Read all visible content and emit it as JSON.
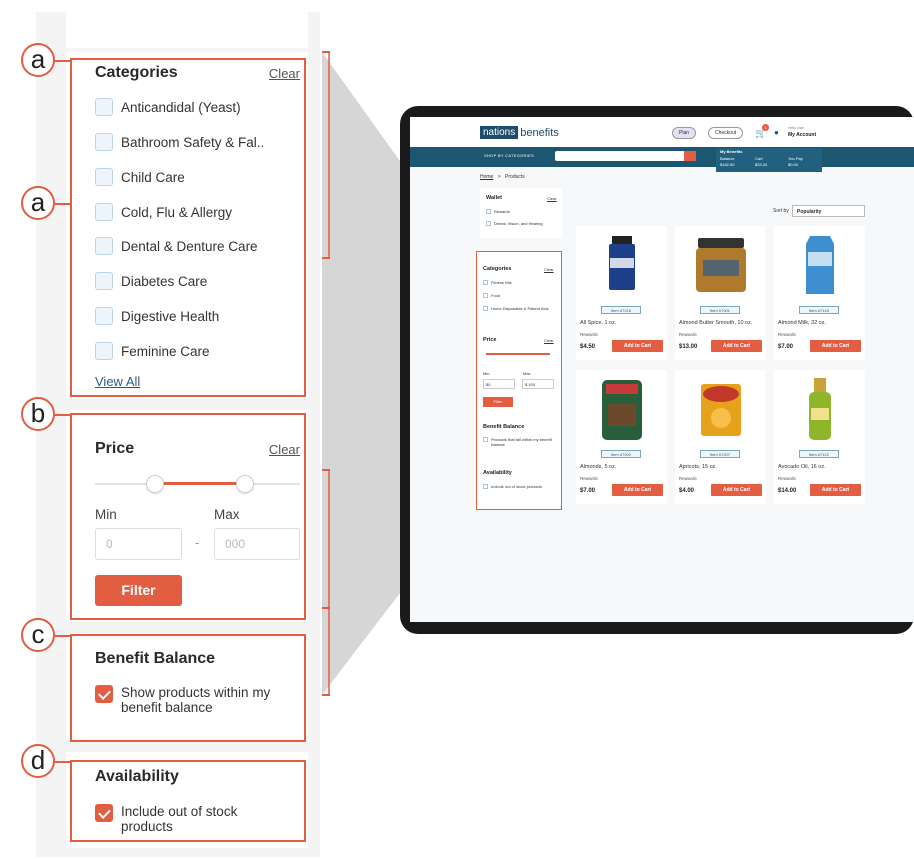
{
  "annotations": [
    "a",
    "a",
    "b",
    "c",
    "d"
  ],
  "filters": {
    "categories": {
      "title": "Categories",
      "clear": "Clear",
      "items": [
        "Anticandidal (Yeast)",
        "Bathroom Safety & Fal..",
        "Child Care",
        "Cold, Flu & Allergy",
        "Dental & Denture Care",
        "Diabetes Care",
        "Digestive Health",
        "Feminine Care"
      ],
      "view_all": "View All"
    },
    "price": {
      "title": "Price",
      "clear": "Clear",
      "min_label": "Min",
      "max_label": "Max",
      "min_placeholder": "0",
      "max_placeholder": "000",
      "separator": "-",
      "filter_button": "Filter"
    },
    "benefit_balance": {
      "title": "Benefit Balance",
      "option": "Show products within my benefit balance",
      "checked": true
    },
    "availability": {
      "title": "Availability",
      "option": "Include out of stock products",
      "checked": true
    }
  },
  "tablet": {
    "logo_box": "nations",
    "logo_rest": "benefits",
    "header_pill_1": "Plan",
    "header_pill_2": "Checkout",
    "cart_badge": "1",
    "account_greeting": "Hello User",
    "account": "My Account",
    "nav_shop": "SHOP BY CATEGORIES",
    "benefits_title": "My Benefits",
    "benefits": [
      {
        "label": "Balance",
        "value": "$182.50"
      },
      {
        "label": "Cart",
        "value": "$33.20"
      },
      {
        "label": "You Pay",
        "value": "$0.00"
      }
    ],
    "breadcrumb_home": "Home",
    "breadcrumb_sep": ">",
    "breadcrumb_current": "Products",
    "wallet": {
      "title": "Wallet",
      "clear": "Clear",
      "items": [
        "Rewards",
        "Dental, Vision, and Hearing"
      ]
    },
    "sidebar": {
      "categories_title": "Categories",
      "categories_clear": "Clear",
      "categories_items": [
        "Fitness Kits",
        "Food",
        "Home Disposable & Patient Aids"
      ],
      "price_title": "Price",
      "price_clear": "Clear",
      "min_label": "Min",
      "max_label": "Max",
      "min_value": "$0",
      "max_value": "$ 100",
      "filter_button": "Filter",
      "benefit_title": "Benefit Balance",
      "benefit_option": "Products that fall within my benefit balance",
      "availability_title": "Availability",
      "availability_option": "Include out of stock products"
    },
    "sort_label": "Sort by",
    "sort_value": "Popularity",
    "products": [
      {
        "item": "Item #7218",
        "name": "All Spice, 1 oz.",
        "rewards": "Rewards",
        "price": "$4.50",
        "button": "Add to Cart",
        "color": "#1e3f8a"
      },
      {
        "item": "Item #7001",
        "name": "Almond Butter Smooth, 10 oz.",
        "rewards": "Rewards",
        "price": "$13.00",
        "button": "Add to Cart",
        "color": "#b07a2c"
      },
      {
        "item": "Item #7143",
        "name": "Almond Milk, 32 oz.",
        "rewards": "Rewards",
        "price": "$7.00",
        "button": "Add to Cart",
        "color": "#3e8fd0"
      },
      {
        "item": "Item #7002",
        "name": "Almonds, 5 oz.",
        "rewards": "Rewards",
        "price": "$7.00",
        "button": "Add to Cart",
        "color": "#2a5e3a"
      },
      {
        "item": "Item #7207",
        "name": "Apricots, 15 oz.",
        "rewards": "Rewards",
        "price": "$4.00",
        "button": "Add to Cart",
        "color": "#e6a21d"
      },
      {
        "item": "Item #7122",
        "name": "Avocado Oil, 16 oz.",
        "rewards": "Rewards",
        "price": "$14.00",
        "button": "Add to Cart",
        "color": "#8fb52a"
      }
    ]
  },
  "colors": {
    "accent": "#e25d42",
    "nav": "#1c5670",
    "checkbox_border": "#b9d3e8"
  }
}
